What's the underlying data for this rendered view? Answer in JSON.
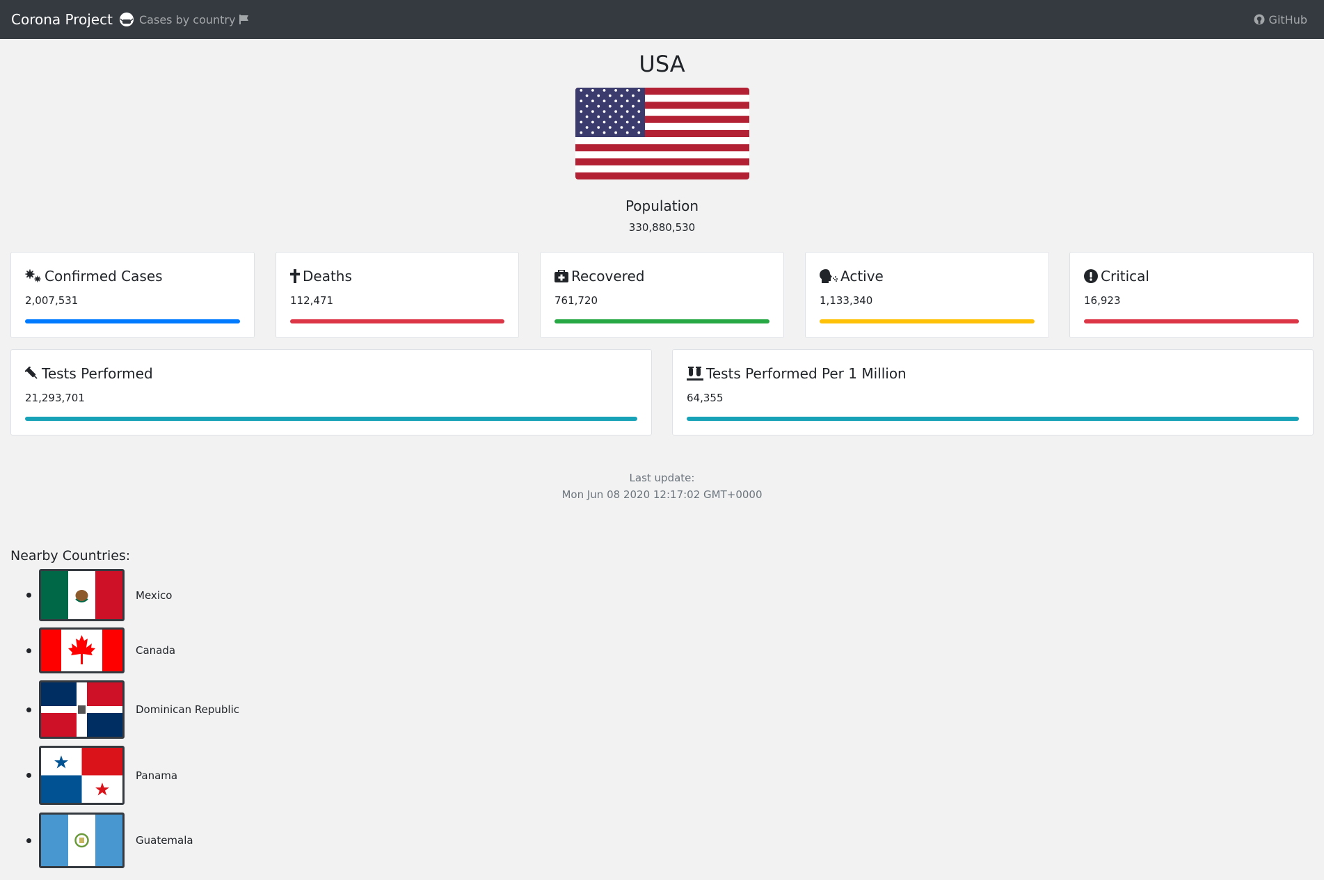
{
  "navbar": {
    "brand": "Corona Project",
    "cases_link": "Cases by country",
    "github": "GitHub"
  },
  "country": {
    "name": "USA",
    "population_label": "Population",
    "population": "330,880,530"
  },
  "stats": [
    {
      "label": "Confirmed Cases",
      "value": "2,007,531",
      "color": "#007bff",
      "icon": "virus-icon"
    },
    {
      "label": "Deaths",
      "value": "112,471",
      "color": "#dc3545",
      "icon": "cross-icon"
    },
    {
      "label": "Recovered",
      "value": "761,720",
      "color": "#28a745",
      "icon": "medkit-icon"
    },
    {
      "label": "Active",
      "value": "1,133,340",
      "color": "#ffc107",
      "icon": "head-cough-icon"
    },
    {
      "label": "Critical",
      "value": "16,923",
      "color": "#dc3545",
      "icon": "exclamation-icon"
    }
  ],
  "tests": [
    {
      "label": "Tests Performed",
      "value": "21,293,701",
      "color": "#17a2b8",
      "icon": "syringe-icon"
    },
    {
      "label": "Tests Performed Per 1 Million",
      "value": "64,355",
      "color": "#17a2b8",
      "icon": "vials-icon"
    }
  ],
  "update": {
    "label": "Last update:",
    "value": "Mon Jun 08 2020 12:17:02 GMT+0000"
  },
  "nearby": {
    "title": "Nearby Countries:",
    "countries": [
      "Mexico",
      "Canada",
      "Dominican Republic",
      "Panama",
      "Guatemala"
    ]
  }
}
